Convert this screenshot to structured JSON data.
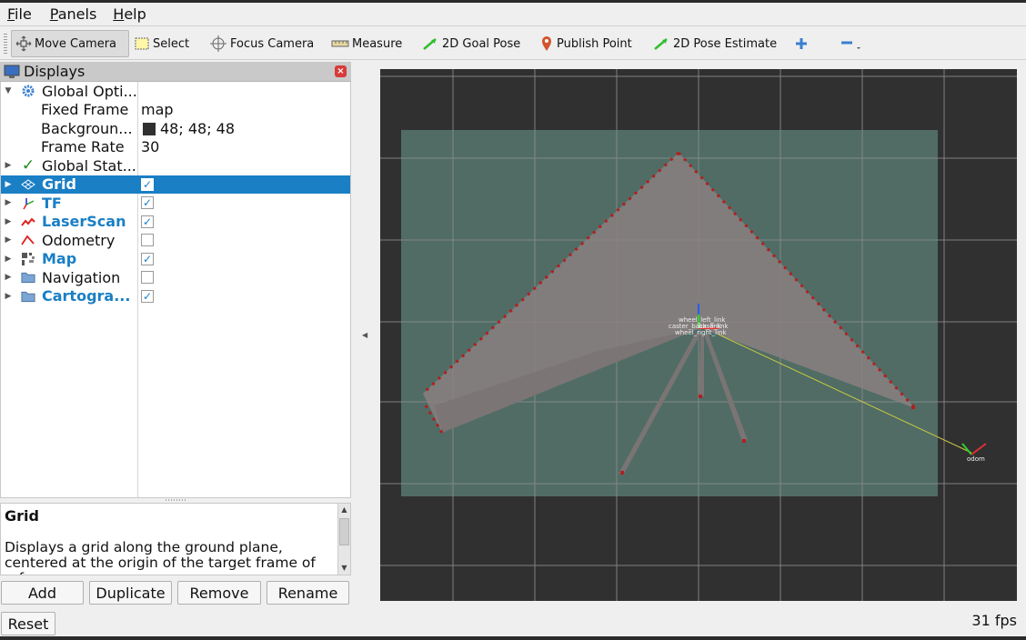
{
  "menu": [
    "File",
    "Panels",
    "Help"
  ],
  "toolbar": {
    "tools": [
      {
        "label": "Move Camera",
        "icon": "move-camera-icon",
        "active": true
      },
      {
        "label": "Select",
        "icon": "select-icon"
      },
      {
        "label": "Focus Camera",
        "icon": "focus-camera-icon"
      },
      {
        "label": "Measure",
        "icon": "measure-icon"
      },
      {
        "label": "2D Goal Pose",
        "icon": "goal-pose-arrow-icon"
      },
      {
        "label": "Publish Point",
        "icon": "map-pin-icon"
      },
      {
        "label": "2D Pose Estimate",
        "icon": "pose-estimate-arrow-icon"
      }
    ],
    "add_tool_icon": "plus-icon",
    "remove_tool_icon": "minus-icon"
  },
  "displays_panel": {
    "title": "Displays",
    "close_icon": "close-icon",
    "tree": [
      {
        "name": "Global Opti...",
        "expanded": true,
        "icon": "gear-icon"
      },
      {
        "name": "Fixed Frame",
        "value": "map",
        "child": true
      },
      {
        "name": "Backgroun...",
        "value": "48; 48; 48",
        "color": "#303030",
        "child": true
      },
      {
        "name": "Frame Rate",
        "value": "30",
        "child": true
      },
      {
        "name": "Global Stat...",
        "icon": "checkmark-icon"
      },
      {
        "name": "Grid",
        "checked": true,
        "selected": true,
        "icon": "grid-icon"
      },
      {
        "name": "TF",
        "checked": true,
        "icon": "tf-axes-icon"
      },
      {
        "name": "LaserScan",
        "checked": true,
        "icon": "laserscan-icon"
      },
      {
        "name": "Odometry",
        "checked": false,
        "icon": "odometry-icon"
      },
      {
        "name": "Map",
        "checked": true,
        "icon": "map-icon"
      },
      {
        "name": "Navigation",
        "checked": false,
        "icon": "folder-icon"
      },
      {
        "name": "Cartogra...",
        "checked": true,
        "icon": "folder-icon"
      }
    ]
  },
  "help": {
    "title": "Grid",
    "body": "Displays a grid along the ground plane, centered at the origin of the target frame of reference."
  },
  "buttons": {
    "add": "Add",
    "duplicate": "Duplicate",
    "remove": "Remove",
    "rename": "Rename",
    "reset": "Reset"
  },
  "status": {
    "fps": "31 fps"
  },
  "viewport": {
    "background": "#303030",
    "map_color": "#527068",
    "laser_color": "#c02020",
    "frames": [
      "wheel_left_link",
      "caster_back_link",
      "base_link",
      "wheel_right_link",
      "odom"
    ]
  }
}
